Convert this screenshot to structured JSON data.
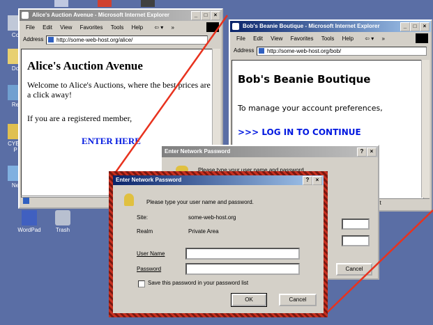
{
  "desktop": {
    "icons": [
      {
        "label": "Co"
      },
      {
        "label": "Do"
      },
      {
        "label": "Re"
      },
      {
        "label": "CYBE\nP"
      },
      {
        "label": "Ne"
      },
      {
        "label": "WordPad"
      },
      {
        "label": "Trash"
      }
    ]
  },
  "alice_window": {
    "title": "Alice's Auction Avenue - Microsoft Internet Explorer",
    "menu": [
      "File",
      "Edit",
      "View",
      "Favorites",
      "Tools",
      "Help"
    ],
    "address_label": "Address",
    "url": "http://some-web-host.org/alice/",
    "heading": "Alice's Auction Avenue",
    "welcome": "Welcome to Alice's Auctions, where the best prices are just a click away!",
    "registered": "If you are a registered member,",
    "enter_here": "ENTER HERE"
  },
  "bob_window": {
    "title": "Bob's Beanie Boutique - Microsoft Internet Explorer",
    "menu": [
      "File",
      "Edit",
      "View",
      "Favorites",
      "Tools",
      "Help"
    ],
    "address_label": "Address",
    "url": "http://some-web-host.org/bob/",
    "heading": "Bob's Beanie Boutique",
    "manage": "To manage your account preferences,",
    "login": ">>> LOG IN TO CONTINUE",
    "status_tail": "et"
  },
  "back_dialog": {
    "title": "Enter Network Password",
    "prompt": "Please type your user name and password.",
    "cancel_label": "Cancel"
  },
  "front_dialog": {
    "title": "Enter Network Password",
    "prompt": "Please type your user name and password.",
    "site_label": "Site:",
    "site_value": "some-web-host.org",
    "realm_label": "Realm",
    "realm_value": "Private Area",
    "username_label": "User Name",
    "password_label": "Password",
    "username_value": "",
    "password_value": "",
    "save_label": "Save this password in your password list",
    "save_checked": false,
    "ok_label": "OK",
    "cancel_label": "Cancel"
  },
  "colors": {
    "desktop": "#5a6ea5",
    "highlight_stripe_a": "#c83020",
    "highlight_stripe_b": "#7a1810",
    "callout_line": "#e8321e",
    "link_blue": "#0018e0"
  }
}
